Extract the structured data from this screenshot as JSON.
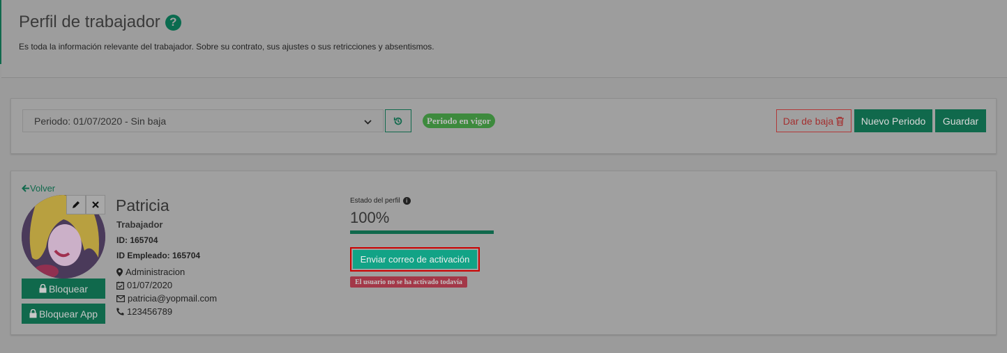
{
  "header": {
    "title": "Perfil de trabajador",
    "help_icon": "question-circle-icon",
    "subtitle": "Es toda la información relevante del trabajador. Sobre su contrato, sus ajustes o sus retricciones y absentismos."
  },
  "period_bar": {
    "selected_period": "Periodo: 01/07/2020 - Sin baja",
    "status_badge": "Periodo en vigor",
    "buttons": {
      "dar_de_baja": "Dar de baja",
      "nuevo_periodo": "Nuevo Periodo",
      "guardar": "Guardar"
    }
  },
  "profile": {
    "back_label": "Volver",
    "name": "Patricia",
    "role": "Trabajador",
    "id_line": "ID: 165704",
    "employee_id_line": "ID Empleado: 165704",
    "department": "Administracion",
    "date": "01/07/2020",
    "email": "patricia@yopmail.com",
    "phone": "123456789",
    "lock_button": "Bloquear",
    "lock_app_button": "Bloquear App"
  },
  "status": {
    "label": "Estado del perfil",
    "percent_text": "100%",
    "progress_fraction": 1.0,
    "activate_button": "Enviar correo de activación",
    "not_activated_badge": "El usuario no se ha activado todavía"
  },
  "colors": {
    "primary_green": "#10694c",
    "teal_button": "#12a386",
    "danger": "#a33030",
    "highlight_border": "#cc0000"
  }
}
